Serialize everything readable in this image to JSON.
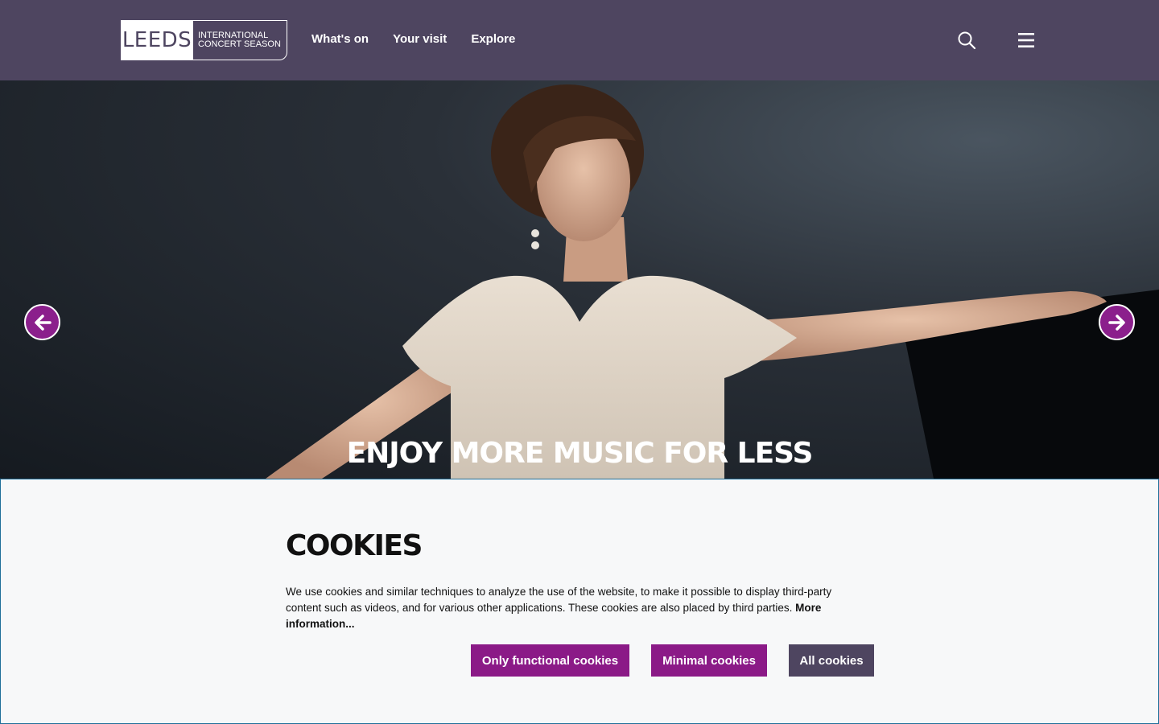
{
  "header": {
    "logo": {
      "main": "LEEDS",
      "line1": "INTERNATIONAL",
      "line2": "CONCERT SEASON"
    },
    "nav": [
      {
        "label": "What's on"
      },
      {
        "label": "Your visit"
      },
      {
        "label": "Explore"
      }
    ],
    "icons": {
      "search": "search-icon",
      "menu": "menu-icon"
    }
  },
  "hero": {
    "title": "ENJOY MORE MUSIC FOR LESS",
    "prev_icon": "arrow-left-icon",
    "next_icon": "arrow-right-icon"
  },
  "cookies": {
    "title": "COOKIES",
    "text": "We use cookies and similar techniques to analyze the use of the website, to make it possible to display third-party content such as videos, and for various other applications. These cookies are also placed by third parties. ",
    "more_link": "More information...",
    "buttons": {
      "functional": "Only functional cookies",
      "minimal": "Minimal cookies",
      "all": "All cookies"
    }
  },
  "colors": {
    "header_bg": "#4e4560",
    "accent_purple": "#8b1a87",
    "panel_bg": "#f7f8f9"
  }
}
